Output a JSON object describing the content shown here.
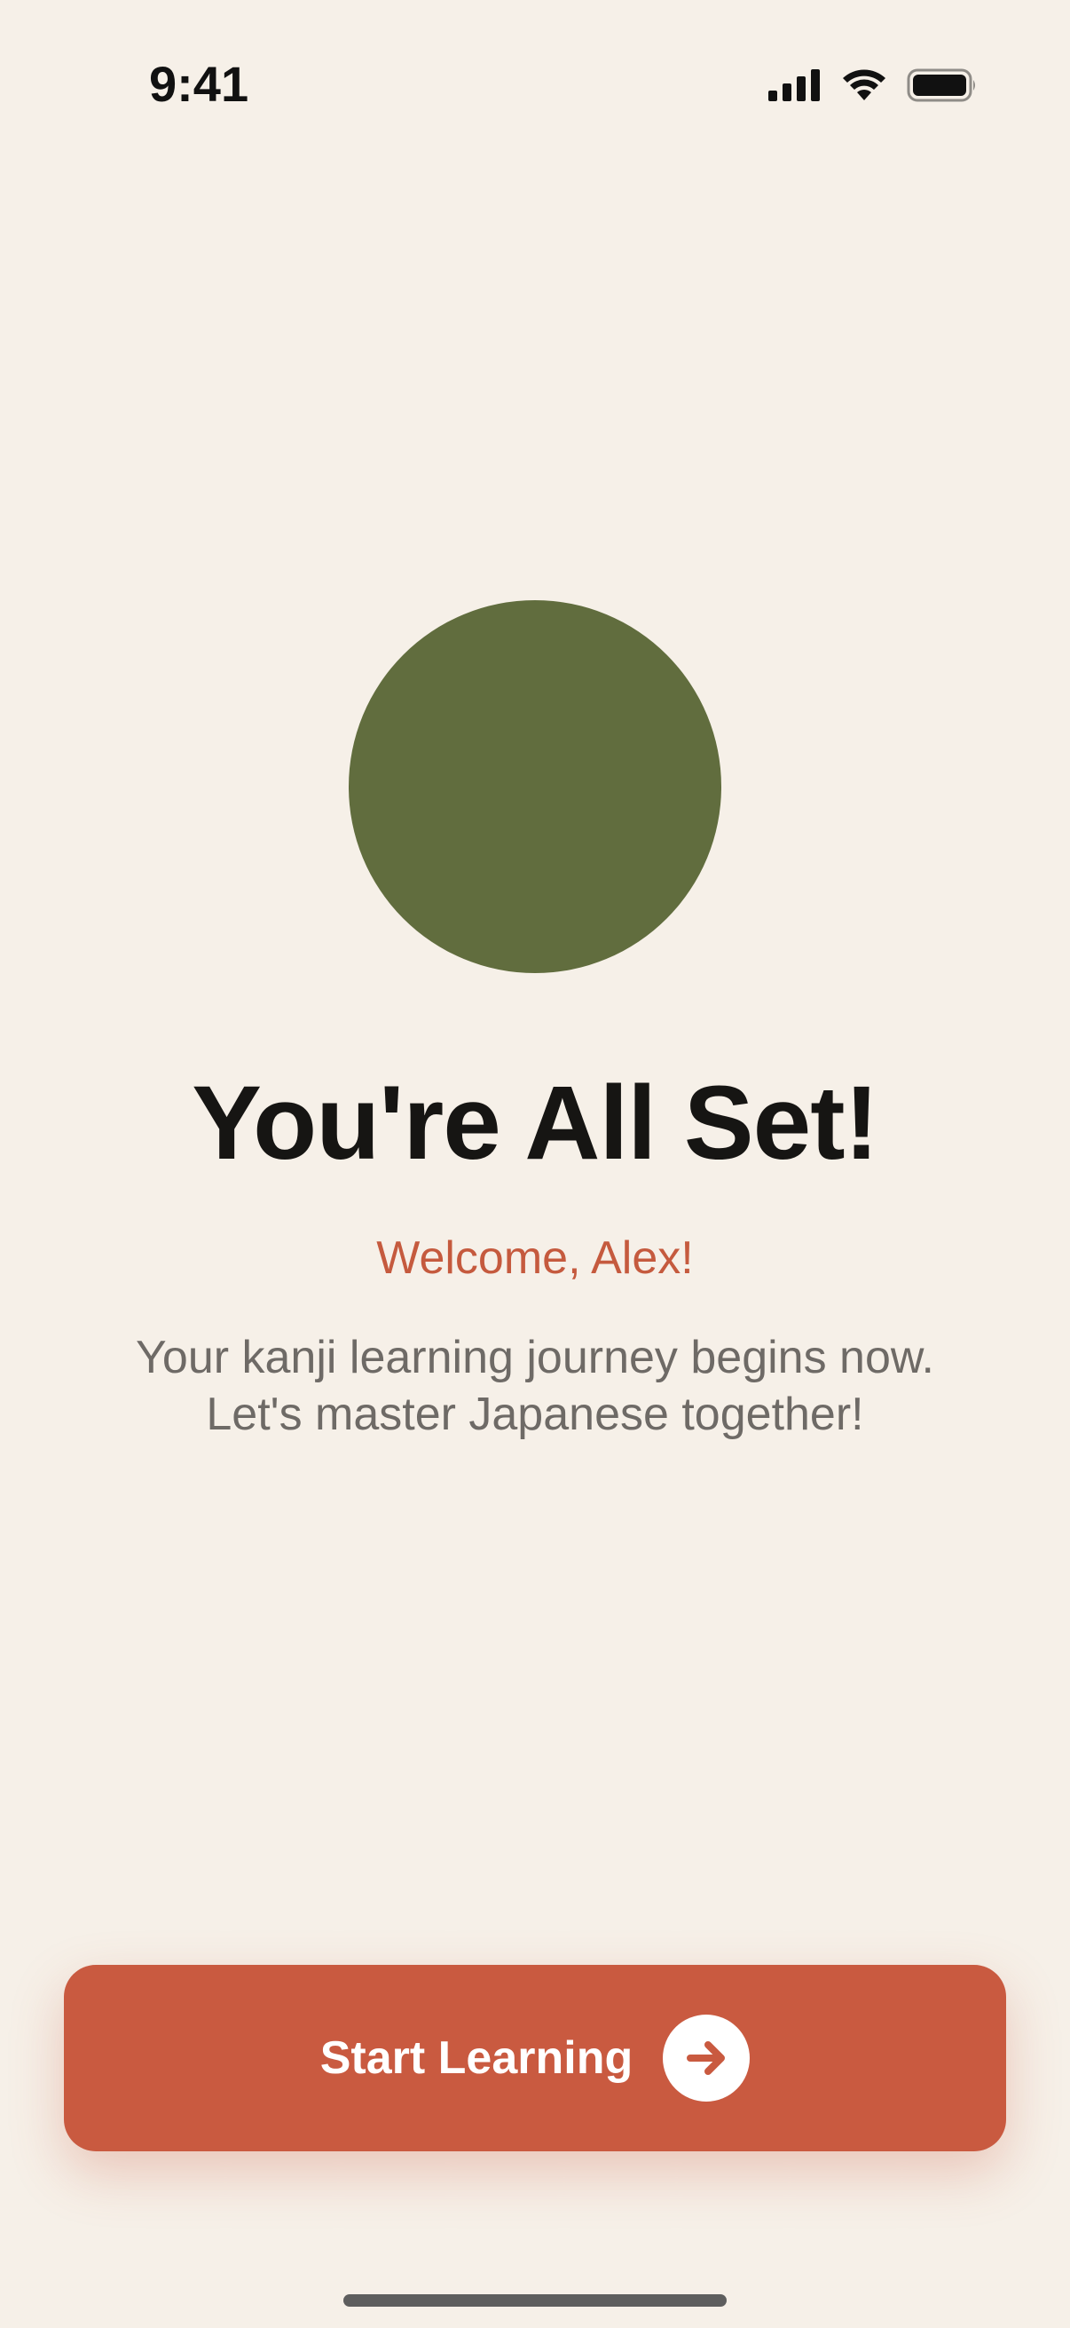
{
  "status_bar": {
    "time": "9:41",
    "icons": [
      "cellular-signal-icon",
      "wifi-icon",
      "battery-icon"
    ]
  },
  "hero": {
    "icon": "circle-illustration",
    "color": "#616D3E"
  },
  "title": "You're All Set!",
  "welcome": "Welcome, Alex!",
  "description": {
    "line1": "Your kanji learning journey begins now.",
    "line2": "Let's master Japanese together!"
  },
  "cta": {
    "label": "Start Learning",
    "icon": "arrow-right-icon",
    "color": "#C95A40"
  },
  "colors": {
    "background": "#F6F0E8",
    "accent": "#C95A40",
    "welcome_text": "#C55A3E",
    "title_text": "#161513",
    "body_text": "#6E6A66"
  }
}
